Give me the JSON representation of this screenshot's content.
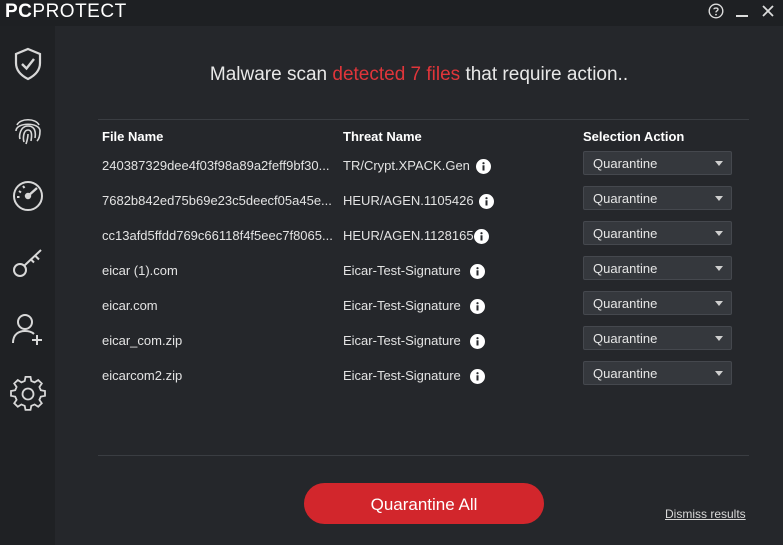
{
  "app": {
    "logo_bold": "PC",
    "logo_rest": "PROTECT"
  },
  "headline": {
    "prefix": "Malware scan ",
    "highlight": "detected 7 files",
    "suffix": " that require action..",
    "highlight_color": "#e0353a"
  },
  "table": {
    "headers": {
      "file": "File Name",
      "threat": "Threat Name",
      "action": "Selection Action"
    },
    "rows": [
      {
        "file": "240387329dee4f03f98a89a2feff9bf30...",
        "threat": "TR/Crypt.XPACK.Gen",
        "action": "Quarantine"
      },
      {
        "file": "7682b842ed75b69e23c5deecf05a45e...",
        "threat": "HEUR/AGEN.1105426",
        "action": "Quarantine"
      },
      {
        "file": "cc13afd5ffdd769c66118f4f5eec7f8065...",
        "threat": "HEUR/AGEN.1128165",
        "action": "Quarantine"
      },
      {
        "file": "eicar (1).com",
        "threat": "Eicar-Test-Signature",
        "action": "Quarantine"
      },
      {
        "file": "eicar.com",
        "threat": "Eicar-Test-Signature",
        "action": "Quarantine"
      },
      {
        "file": "eicar_com.zip",
        "threat": "Eicar-Test-Signature",
        "action": "Quarantine"
      },
      {
        "file": "eicarcom2.zip",
        "threat": "Eicar-Test-Signature",
        "action": "Quarantine"
      }
    ]
  },
  "actions": {
    "quarantine_all": "Quarantine All",
    "dismiss": "Dismiss results"
  },
  "sidebar": {
    "icons": [
      "shield-check-icon",
      "fingerprint-icon",
      "speedometer-icon",
      "key-icon",
      "add-user-icon",
      "gear-icon"
    ]
  },
  "colors": {
    "accent": "#d2262c",
    "background": "#25272b",
    "sidebar": "#1f2124"
  }
}
